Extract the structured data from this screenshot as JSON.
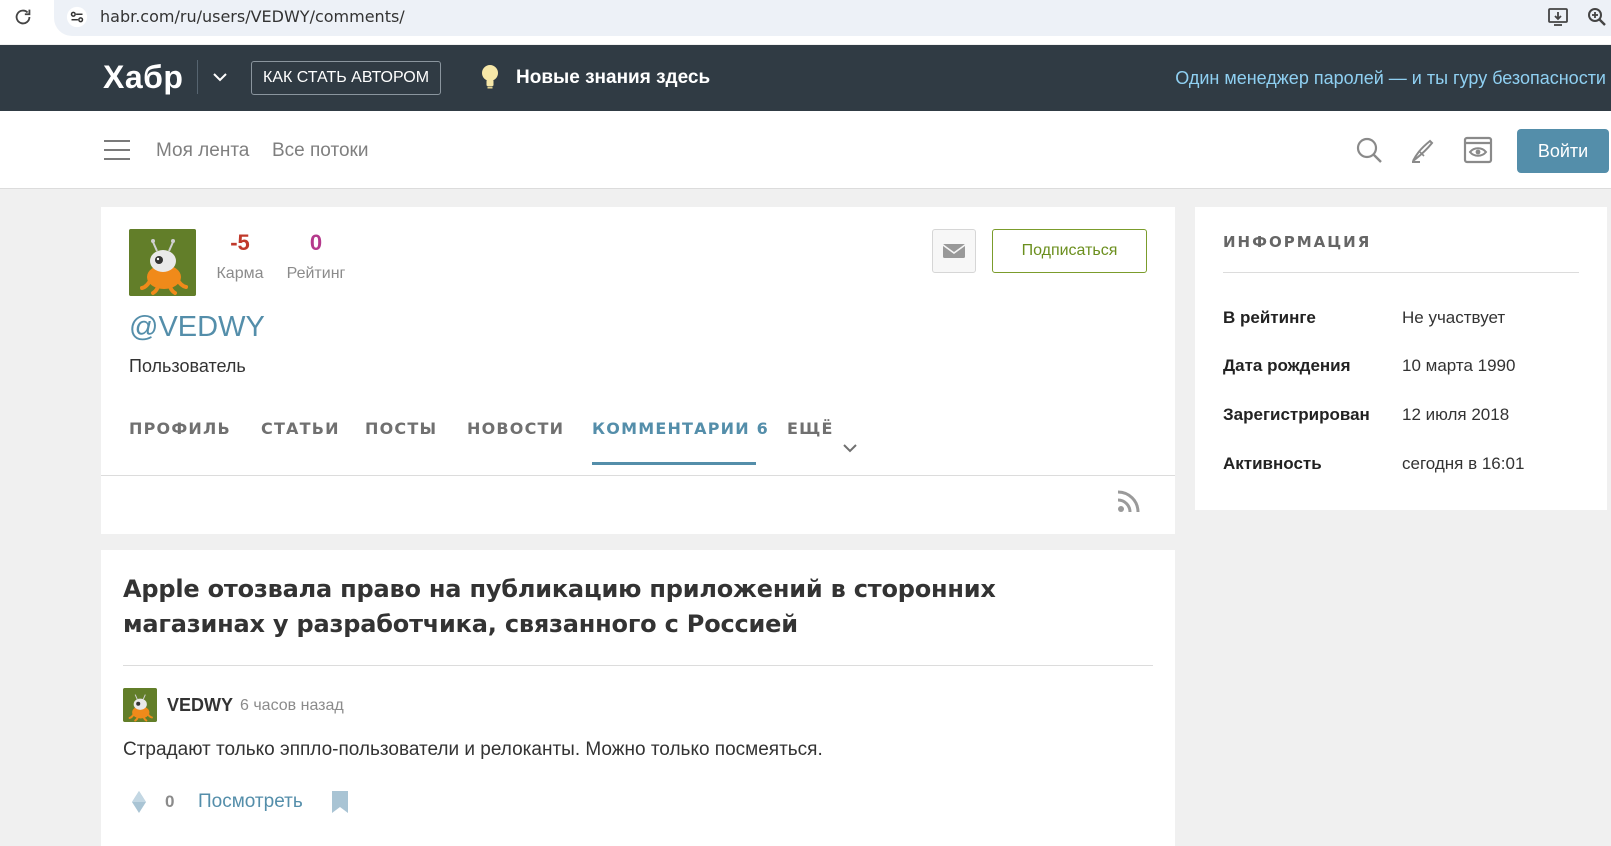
{
  "browser": {
    "url": "habr.com/ru/users/VEDWY/comments/",
    "icons": [
      "reload-icon",
      "site-settings-icon",
      "install-app-icon",
      "zoom-icon"
    ]
  },
  "header": {
    "logo": "Хабр",
    "how_to_author": "КАК СТАТЬ АВТОРОМ",
    "new_knowledge": "Новые знания здесь",
    "promo": "Один менеджер паролей — и ты гуру безопасности"
  },
  "nav": {
    "my_feed": "Моя лента",
    "all_streams": "Все потоки",
    "login": "Войти"
  },
  "profile": {
    "karma": {
      "value": "-5",
      "label": "Карма",
      "color": "#c0392b"
    },
    "rating": {
      "value": "0",
      "label": "Рейтинг",
      "color": "#b5398c"
    },
    "handle": "@VEDWY",
    "role": "Пользователь",
    "subscribe": "Подписаться",
    "tabs": [
      {
        "label": "ПРОФИЛЬ"
      },
      {
        "label": "СТАТЬИ"
      },
      {
        "label": "ПОСТЫ"
      },
      {
        "label": "НОВОСТИ"
      },
      {
        "label": "КОММЕНТАРИИ 6",
        "active": true
      },
      {
        "label": "ЕЩЁ"
      }
    ]
  },
  "info": {
    "title": "ИНФОРМАЦИЯ",
    "rows": [
      {
        "key": "В рейтинге",
        "value": "Не участвует"
      },
      {
        "key": "Дата рождения",
        "value": "10 марта 1990"
      },
      {
        "key": "Зарегистрирован",
        "value": "12 июля 2018"
      },
      {
        "key": "Активность",
        "value": "сегодня в 16:01"
      }
    ]
  },
  "comment": {
    "article_title": "Apple отозвала право на публикацию приложений в сторонних магазинах у разработчика, связанного с Россией",
    "user": "VEDWY",
    "time": "6 часов назад",
    "text": "Страдают только эппло-пользователи и релоканты. Можно только посмеяться.",
    "votes": "0",
    "view": "Посмотреть"
  },
  "colors": {
    "accent": "#548eaa",
    "topbar": "#303b44",
    "subscribe": "#6b8f1e"
  }
}
